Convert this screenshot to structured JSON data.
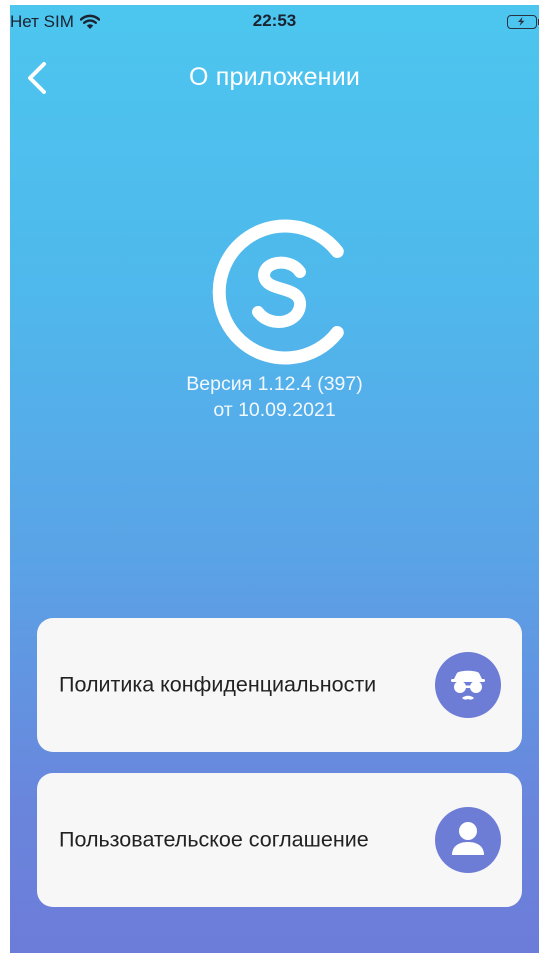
{
  "status_bar": {
    "carrier": "Нет SIM",
    "time": "22:53",
    "icons": [
      "wifi-icon",
      "battery-charging-icon"
    ]
  },
  "nav": {
    "title": "О приложении",
    "back_icon": "chevron-left-icon"
  },
  "app_info": {
    "logo_icon": "app-logo-s",
    "version_line": "Версия 1.12.4 (397)",
    "date_line": "от 10.09.2021"
  },
  "menu": {
    "items": [
      {
        "label": "Политика конфиденциальности",
        "icon": "incognito-glasses-icon"
      },
      {
        "label": "Пользовательское соглашение",
        "icon": "user-icon"
      }
    ]
  },
  "colors": {
    "gradient_top": "#4cc6ef",
    "gradient_bottom": "#6c7cd9",
    "card_background": "#f7f7f8",
    "icon_circle": "#6d7dd6"
  }
}
